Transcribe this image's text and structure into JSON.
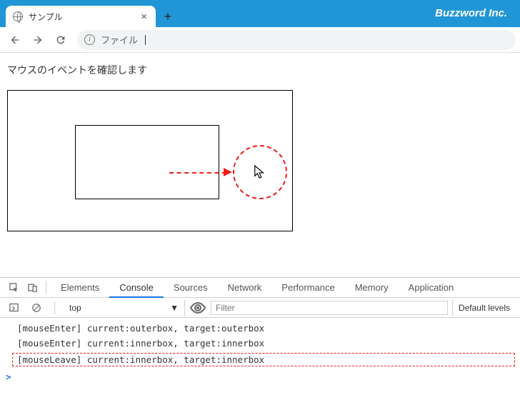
{
  "brand": "Buzzword Inc.",
  "tab": {
    "title": "サンプル"
  },
  "urlbar": {
    "label": "ファイル"
  },
  "page": {
    "heading": "マウスのイベントを確認します"
  },
  "devtools": {
    "tabs": {
      "elements": "Elements",
      "console": "Console",
      "sources": "Sources",
      "network": "Network",
      "performance": "Performance",
      "memory": "Memory",
      "application": "Application"
    },
    "toolbar": {
      "context": "top",
      "filter_placeholder": "Filter",
      "levels": "Default levels"
    },
    "console": [
      "[mouseEnter] current:outerbox, target:outerbox",
      "[mouseEnter] current:innerbox, target:innerbox",
      "[mouseLeave] current:innerbox, target:innerbox"
    ],
    "prompt": ">"
  }
}
